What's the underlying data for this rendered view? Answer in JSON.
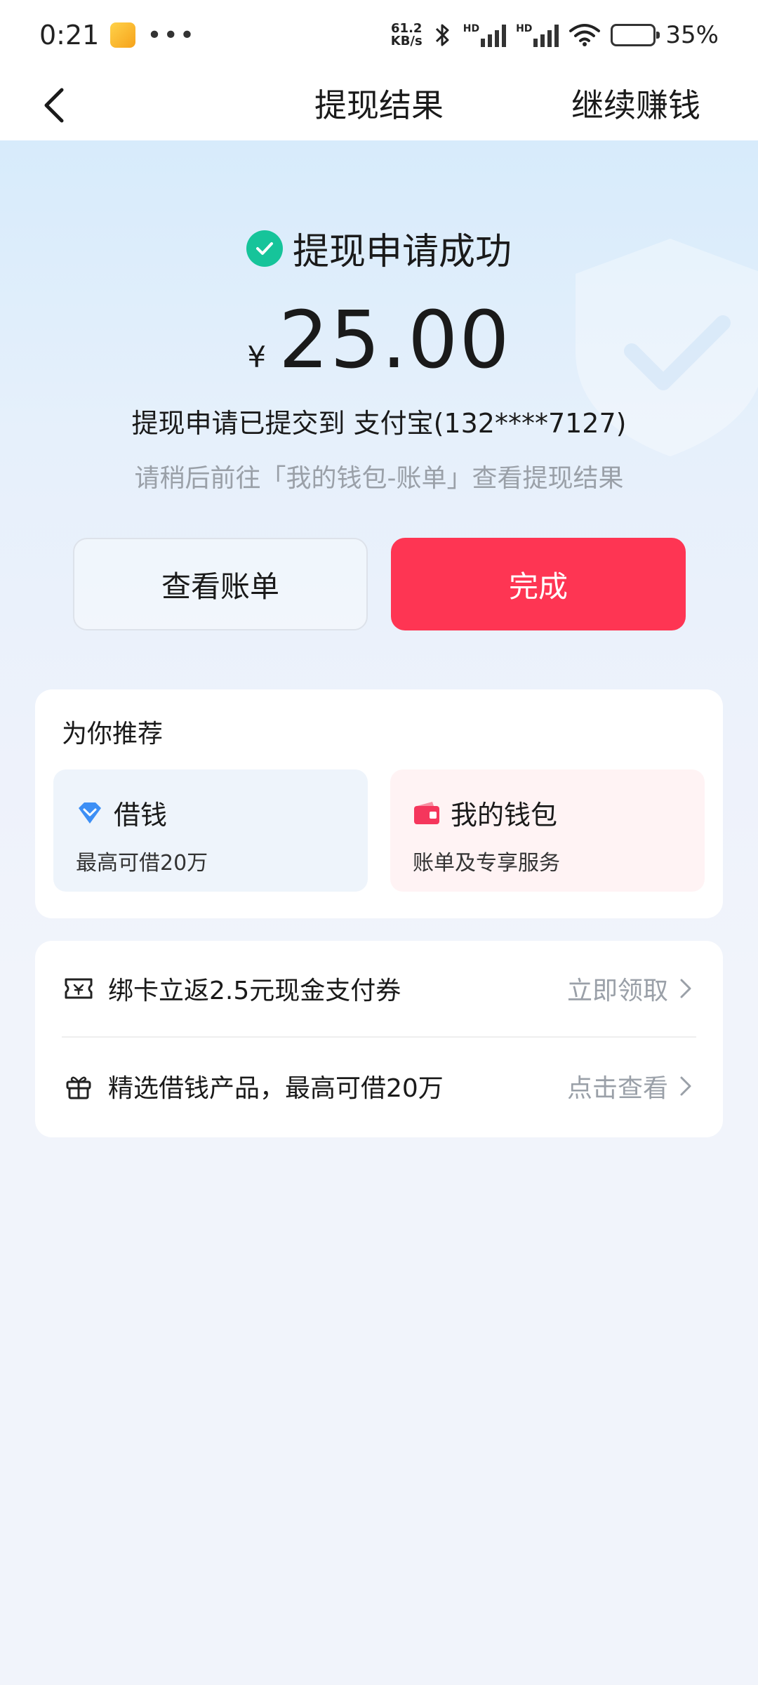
{
  "status_bar": {
    "time": "0:21",
    "net_speed_value": "61.2",
    "net_speed_unit": "KB/s",
    "signal_1_label": "HD",
    "signal_2_label": "HD",
    "battery_percent": "35%"
  },
  "header": {
    "title": "提现结果",
    "action_label": "继续赚钱"
  },
  "result": {
    "status_text": "提现申请成功",
    "currency_symbol": "¥",
    "amount": "25.00",
    "submitted_text": "提现申请已提交到 支付宝(132****7127)",
    "hint_text": "请稍后前往「我的钱包-账单」查看提现结果"
  },
  "buttons": {
    "view_bill": "查看账单",
    "done": "完成"
  },
  "recommend": {
    "title": "为你推荐",
    "items": [
      {
        "name": "借钱",
        "subtitle": "最高可借20万",
        "icon": "diamond-icon"
      },
      {
        "name": "我的钱包",
        "subtitle": "账单及专享服务",
        "icon": "wallet-icon"
      }
    ]
  },
  "promos": [
    {
      "text": "绑卡立返2.5元现金支付券",
      "action": "立即领取",
      "icon": "ticket-icon"
    },
    {
      "text": "精选借钱产品，最高可借20万",
      "action": "点击查看",
      "icon": "gift-icon"
    }
  ],
  "colors": {
    "primary_button": "#fe3553",
    "success": "#16c49a",
    "muted_text": "#9aa0a8",
    "borrow_icon": "#3d8ff5",
    "wallet_icon": "#f5365c"
  }
}
